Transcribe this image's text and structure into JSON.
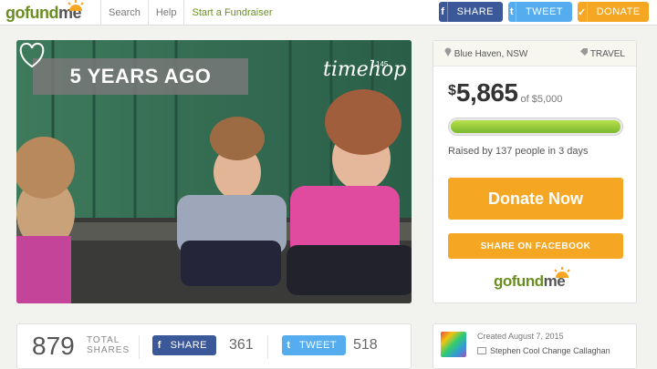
{
  "header": {
    "logo_go": "gofund",
    "logo_me": "me",
    "nav": [
      "Search",
      "Help",
      "Start a Fundraiser"
    ],
    "share_label": "SHARE",
    "tweet_label": "TWEET",
    "donate_label": "DONATE"
  },
  "photo": {
    "overlay_text": "5 YEARS AGO",
    "watermark": "timehop",
    "watermark_count": "145"
  },
  "campaign": {
    "location": "Blue Haven, NSW",
    "category": "TRAVEL",
    "currency": "$",
    "raised": "5,865",
    "goal_text": "of $5,000",
    "progress": 1.0,
    "raised_by": "Raised by 137 people in 3 days",
    "donate_now": "Donate Now",
    "share_facebook": "SHARE ON FACEBOOK",
    "card_logo_go": "gofund",
    "card_logo_me": "me"
  },
  "shares": {
    "total": "879",
    "total_label_1": "TOTAL",
    "total_label_2": "SHARES",
    "fb_label": "SHARE",
    "fb_count": "361",
    "tw_label": "TWEET",
    "tw_count": "518"
  },
  "organizer": {
    "created": "Created August 7, 2015",
    "name": "Stephen Cool Change Callaghan"
  },
  "colors": {
    "facebook": "#3b5998",
    "twitter": "#55acee",
    "donate": "#f5a623",
    "brand_green": "#6b8e23"
  }
}
